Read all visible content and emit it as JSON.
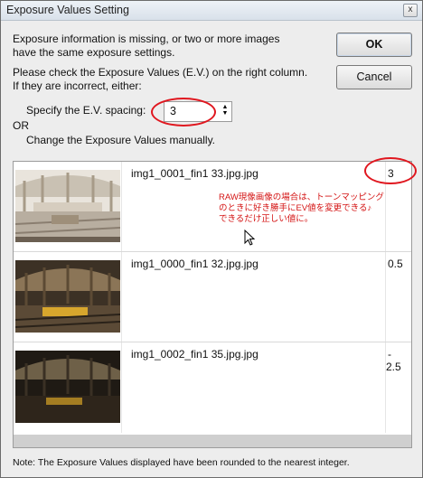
{
  "window": {
    "title": "Exposure Values Setting",
    "close_label": "x"
  },
  "message": {
    "line1": "Exposure information is missing, or two or more images",
    "line2": "have the same exposure settings.",
    "line3": "Please check the Exposure Values (E.V.) on the right column.",
    "line4": "If they are incorrect, either:",
    "spacing_label": "Specify the E.V. spacing:",
    "or_label": "OR",
    "manual_label": "Change the Exposure Values manually."
  },
  "spacing_select": {
    "value": "3",
    "arrows": "▲▼"
  },
  "buttons": {
    "ok": "OK",
    "cancel": "Cancel"
  },
  "images": [
    {
      "filename": "img1_0001_fin1 33.jpg.jpg",
      "ev": "3"
    },
    {
      "filename": "img1_0000_fin1 32.jpg.jpg",
      "ev": "0.5"
    },
    {
      "filename": "img1_0002_fin1 35.jpg.jpg",
      "ev_line1": "-",
      "ev_line2": "2.5"
    }
  ],
  "annotation": {
    "line1": "RAW現像画像の場合は、トーンマッピング",
    "line2": "のときに好き勝手にEV値を変更できる♪",
    "line3": "できるだけ正しい値に。",
    "color": "#d41414"
  },
  "footer_note": "Note: The Exposure Values displayed have been rounded to the nearest integer."
}
